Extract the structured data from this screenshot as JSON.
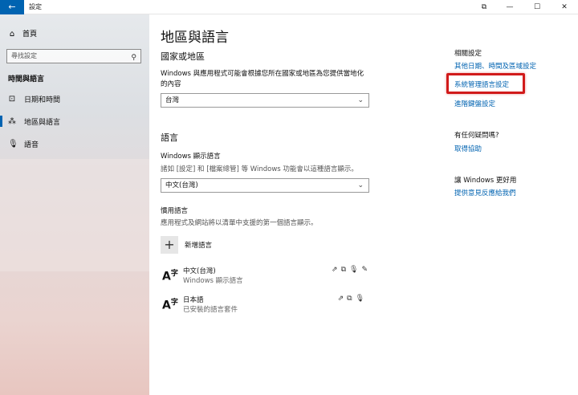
{
  "window": {
    "back_glyph": "←",
    "title": "設定",
    "buttons": {
      "extra": "⧉",
      "minimize": "—",
      "maximize": "☐",
      "close": "✕"
    }
  },
  "sidebar": {
    "home_label": "首頁",
    "search_placeholder": "尋找設定",
    "section_title": "時間與語言",
    "items": [
      {
        "label": "日期和時間",
        "icon": "calendar-clock-icon",
        "glyph": "⊡"
      },
      {
        "label": "地區與語言",
        "icon": "region-language-icon",
        "glyph": "⁂",
        "active": true
      },
      {
        "label": "語音",
        "icon": "microphone-icon",
        "glyph": "🎙"
      }
    ]
  },
  "main": {
    "title": "地區與語言",
    "region": {
      "heading": "國家或地區",
      "description_line1": "Windows 與應用程式可能會根據您所在國家或地區為您提供當地化",
      "description_line2": "的內容",
      "selected": "台灣"
    },
    "language": {
      "heading": "語言",
      "display_label": "Windows 顯示語言",
      "display_desc": "諸如 [設定] 和 [檔案總管] 等 Windows 功能會以這種語言顯示。",
      "display_selected": "中文(台灣)",
      "preferred_label": "慣用語言",
      "preferred_desc": "應用程式及網站將以清單中支援的第一個語言顯示。",
      "add_label": "新增語言",
      "list": [
        {
          "name": "中文(台灣)",
          "sub": "Windows 顯示語言",
          "features": [
            "⇗",
            "⧉",
            "🎙",
            "✎"
          ]
        },
        {
          "name": "日本語",
          "sub": "已安裝的語言套件",
          "features": [
            "⇗",
            "⧉",
            "🎙"
          ]
        }
      ]
    }
  },
  "right": {
    "related_title": "相關設定",
    "links": [
      "其他日期、時間及區域設定",
      "系統管理語言設定",
      "進階鍵盤設定"
    ],
    "question_title": "有任何疑問嗎?",
    "help_link": "取得協助",
    "improve_title": "讓 Windows 更好用",
    "feedback_link": "提供意見反應給我們"
  }
}
